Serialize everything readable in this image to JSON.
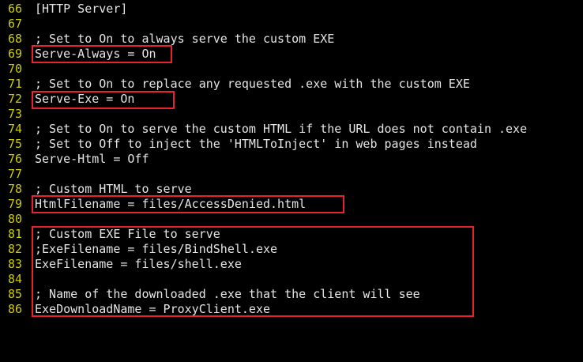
{
  "editor": {
    "lines": [
      {
        "num": "66",
        "text": "[HTTP Server]"
      },
      {
        "num": "67",
        "text": ""
      },
      {
        "num": "68",
        "text": "; Set to On to always serve the custom EXE"
      },
      {
        "num": "69",
        "text": "Serve-Always = On"
      },
      {
        "num": "70",
        "text": ""
      },
      {
        "num": "71",
        "text": "; Set to On to replace any requested .exe with the custom EXE"
      },
      {
        "num": "72",
        "text": "Serve-Exe = On"
      },
      {
        "num": "73",
        "text": ""
      },
      {
        "num": "74",
        "text": "; Set to On to serve the custom HTML if the URL does not contain .exe"
      },
      {
        "num": "75",
        "text": "; Set to Off to inject the 'HTMLToInject' in web pages instead"
      },
      {
        "num": "76",
        "text": "Serve-Html = Off"
      },
      {
        "num": "77",
        "text": ""
      },
      {
        "num": "78",
        "text": "; Custom HTML to serve"
      },
      {
        "num": "79",
        "text": "HtmlFilename = files/AccessDenied.html"
      },
      {
        "num": "80",
        "text": ""
      },
      {
        "num": "81",
        "text": "; Custom EXE File to serve"
      },
      {
        "num": "82",
        "text": ";ExeFilename = files/BindShell.exe"
      },
      {
        "num": "83",
        "text": "ExeFilename = files/shell.exe"
      },
      {
        "num": "84",
        "text": ""
      },
      {
        "num": "85",
        "text": "; Name of the downloaded .exe that the client will see"
      },
      {
        "num": "86",
        "text": "ExeDownloadName = ProxyClient.exe"
      }
    ]
  },
  "colors": {
    "background": "#000000",
    "line_number": "#cdcd00",
    "text": "#e5e5e5",
    "highlight_box": "#e8232f"
  }
}
